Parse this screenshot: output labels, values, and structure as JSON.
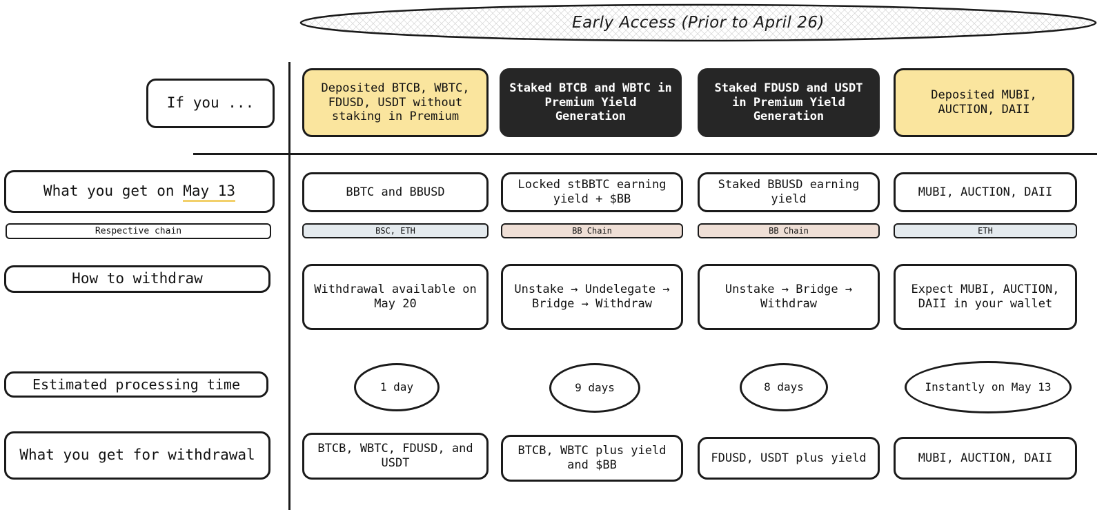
{
  "banner": {
    "text": "Early Access (Prior to April 26)"
  },
  "columns": [
    {
      "id": "col-no-stake",
      "header": "Deposited BTCB, WBTC, FDUSD, USDT without staking in Premium",
      "header_style": "yellow",
      "may13": "BBTC and BBUSD",
      "chain": "BSC, ETH",
      "chain_style": "chain-eth",
      "withdraw": "Withdrawal available on May 20",
      "time": "1 day",
      "result": "BTCB, WBTC, FDUSD, and USDT"
    },
    {
      "id": "col-staked-btc",
      "header": "Staked BTCB and WBTC in Premium Yield Generation",
      "header_style": "dark",
      "may13": "Locked stBBTC earning yield + $BB",
      "chain": "BB Chain",
      "chain_style": "chain-bb",
      "withdraw": "Unstake → Undelegate → Bridge → Withdraw",
      "time": "9 days",
      "result": "BTCB, WBTC plus yield and $BB"
    },
    {
      "id": "col-staked-stable",
      "header": "Staked FDUSD and USDT in Premium Yield Generation",
      "header_style": "dark",
      "may13": "Staked BBUSD earning yield",
      "chain": "BB Chain",
      "chain_style": "chain-bb",
      "withdraw": "Unstake → Bridge → Withdraw",
      "time": "8 days",
      "result": "FDUSD, USDT plus yield"
    },
    {
      "id": "col-tokens",
      "header": "Deposited MUBI, AUCTION, DAII",
      "header_style": "yellow",
      "may13": "MUBI, AUCTION, DAII",
      "chain": "ETH",
      "chain_style": "chain-eth",
      "withdraw": "Expect MUBI, AUCTION, DAII in your wallet",
      "time": "Instantly on May 13",
      "result": "MUBI, AUCTION, DAII"
    }
  ],
  "row_labels": {
    "if_you": "If you ...",
    "may13_prefix": "What you get on ",
    "may13_highlight": "May 13",
    "respective_chain": "Respective chain",
    "how_to_withdraw": "How to withdraw",
    "processing_time": "Estimated processing time",
    "withdrawal_result": "What you get for withdrawal"
  },
  "colors": {
    "yellow": "#fae59e",
    "dark": "#262626",
    "chain_eth": "#e4eaee",
    "chain_bb": "#efdfd6",
    "highlight_underline": "#f2d06b",
    "ink": "#1a1a1a"
  }
}
